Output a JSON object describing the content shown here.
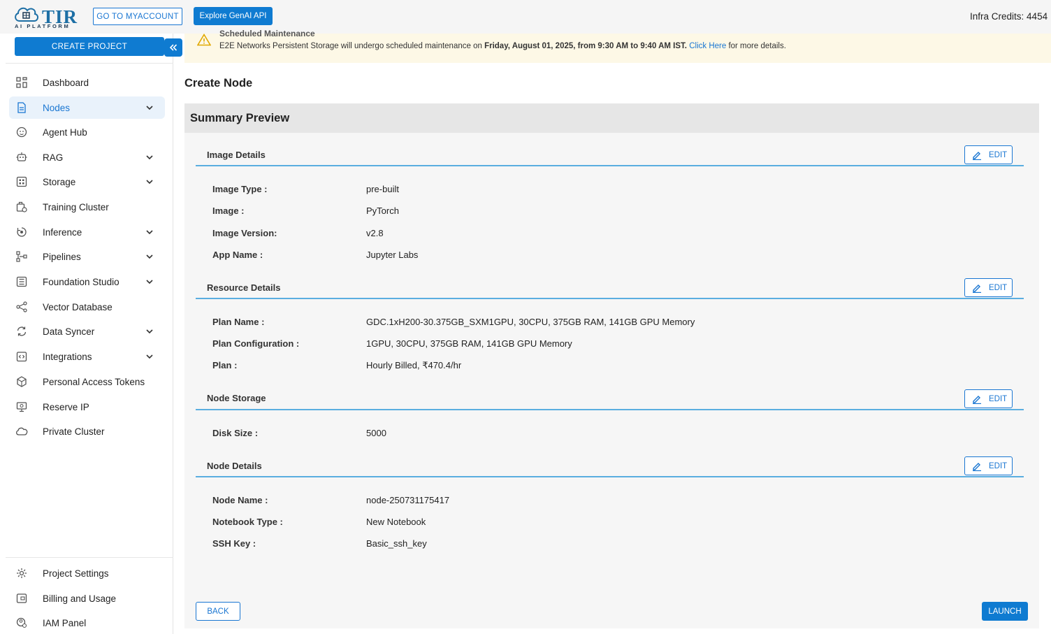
{
  "header": {
    "logo_text": "TIR",
    "logo_sub": "AI PLATFORM",
    "myaccount_label": "GO TO MYACCOUNT",
    "genai_label": "Explore GenAI API",
    "credits_label": "Infra Credits:",
    "credits_value": "4454"
  },
  "sidebar": {
    "create_project_label": "CREATE PROJECT",
    "items": [
      {
        "label": "Dashboard",
        "icon": "dashboard-icon",
        "chevron": false
      },
      {
        "label": "Nodes",
        "icon": "document-icon",
        "chevron": true,
        "active": true
      },
      {
        "label": "Agent Hub",
        "icon": "agent-icon",
        "chevron": false
      },
      {
        "label": "RAG",
        "icon": "robot-icon",
        "chevron": true
      },
      {
        "label": "Storage",
        "icon": "grid-icon",
        "chevron": true
      },
      {
        "label": "Training Cluster",
        "icon": "training-cluster-icon",
        "chevron": false
      },
      {
        "label": "Inference",
        "icon": "inference-icon",
        "chevron": true
      },
      {
        "label": "Pipelines",
        "icon": "pipeline-icon",
        "chevron": true
      },
      {
        "label": "Foundation Studio",
        "icon": "studio-icon",
        "chevron": true
      },
      {
        "label": "Vector Database",
        "icon": "vector-icon",
        "chevron": false
      },
      {
        "label": "Data Syncer",
        "icon": "sync-icon",
        "chevron": true
      },
      {
        "label": "Integrations",
        "icon": "integrations-icon",
        "chevron": true
      },
      {
        "label": "Personal Access Tokens",
        "icon": "token-icon",
        "chevron": false
      },
      {
        "label": "Reserve IP",
        "icon": "ip-icon",
        "chevron": false
      },
      {
        "label": "Private Cluster",
        "icon": "cloud-icon",
        "chevron": false
      }
    ],
    "bottom_items": [
      {
        "label": "Project Settings",
        "icon": "gear-icon"
      },
      {
        "label": "Billing and Usage",
        "icon": "billing-icon"
      },
      {
        "label": "IAM Panel",
        "icon": "iam-icon"
      }
    ]
  },
  "banner": {
    "title": "Scheduled Maintenance",
    "text_before": "E2E Networks Persistent Storage will undergo scheduled maintenance on ",
    "text_bold": "Friday, August 01, 2025, from 9:30 AM to 9:40 AM IST.",
    "link_text": "Click Here",
    "text_after": " for more details."
  },
  "page": {
    "title": "Create Node",
    "summary_title": "Summary Preview",
    "edit_label": "EDIT",
    "back_label": "BACK",
    "launch_label": "LAUNCH"
  },
  "sections": {
    "image": {
      "title": "Image Details",
      "rows": [
        {
          "label": "Image Type :",
          "value": "pre-built"
        },
        {
          "label": "Image :",
          "value": "PyTorch"
        },
        {
          "label": "Image Version:",
          "value": "v2.8"
        },
        {
          "label": "App Name :",
          "value": "Jupyter Labs"
        }
      ]
    },
    "resource": {
      "title": "Resource Details",
      "rows": [
        {
          "label": "Plan Name :",
          "value": "GDC.1xH200-30.375GB_SXM1GPU, 30CPU, 375GB RAM, 141GB GPU Memory"
        },
        {
          "label": "Plan Configuration :",
          "value": "1GPU, 30CPU, 375GB RAM, 141GB GPU Memory"
        },
        {
          "label": "Plan :",
          "value": "Hourly Billed, ₹470.4/hr"
        }
      ]
    },
    "storage": {
      "title": "Node Storage",
      "rows": [
        {
          "label": "Disk Size :",
          "value": "5000"
        }
      ]
    },
    "details": {
      "title": "Node Details",
      "rows": [
        {
          "label": "Node Name :",
          "value": "node-250731175417"
        },
        {
          "label": "Notebook Type :",
          "value": "New Notebook"
        },
        {
          "label": "SSH Key :",
          "value": "Basic_ssh_key"
        }
      ]
    }
  },
  "colors": {
    "primary": "#0f7bd1",
    "accent_line": "#5aaee0",
    "banner_bg": "#fdf8e6"
  }
}
